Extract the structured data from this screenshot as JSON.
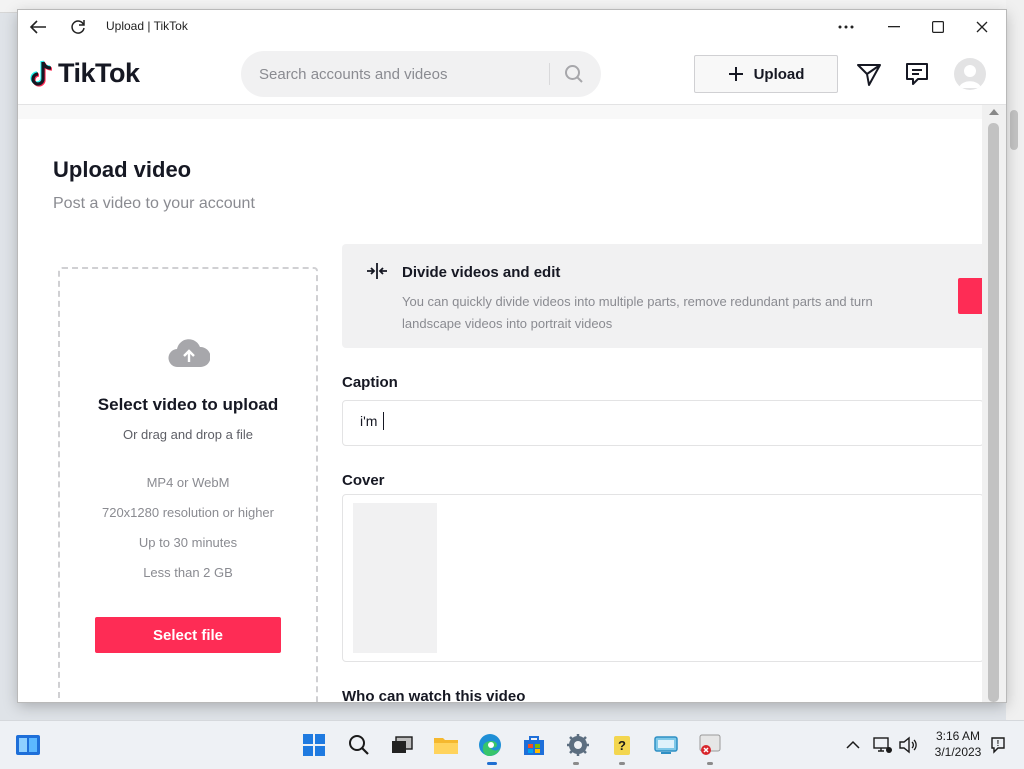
{
  "window": {
    "title": "Upload | TikTok",
    "controls": [
      "more-icon",
      "minimize-icon",
      "maximize-icon",
      "close-icon"
    ]
  },
  "header": {
    "logo_text": "TikTok",
    "search_placeholder": "Search accounts and videos",
    "upload_label": "Upload",
    "icons": [
      "send-icon",
      "message-icon",
      "avatar"
    ]
  },
  "upload_page": {
    "title": "Upload video",
    "subtitle": "Post a video to your account",
    "dropzone": {
      "title": "Select video to upload",
      "subtitle": "Or drag and drop a file",
      "specs": [
        "MP4 or WebM",
        "720x1280 resolution or higher",
        "Up to 30 minutes",
        "Less than 2 GB"
      ],
      "button_label": "Select file"
    },
    "banner": {
      "title": "Divide videos and edit",
      "text": "You can quickly divide videos into multiple parts, remove redundant parts and turn landscape videos into portrait videos"
    },
    "caption_label": "Caption",
    "caption_value": "i'm",
    "cover_label": "Cover",
    "privacy_label": "Who can watch this video"
  },
  "taskbar": {
    "time": "3:16 AM",
    "date": "3/1/2023"
  },
  "colors": {
    "accent": "#fe2c55",
    "text": "#161823",
    "muted": "#8a8b91"
  }
}
